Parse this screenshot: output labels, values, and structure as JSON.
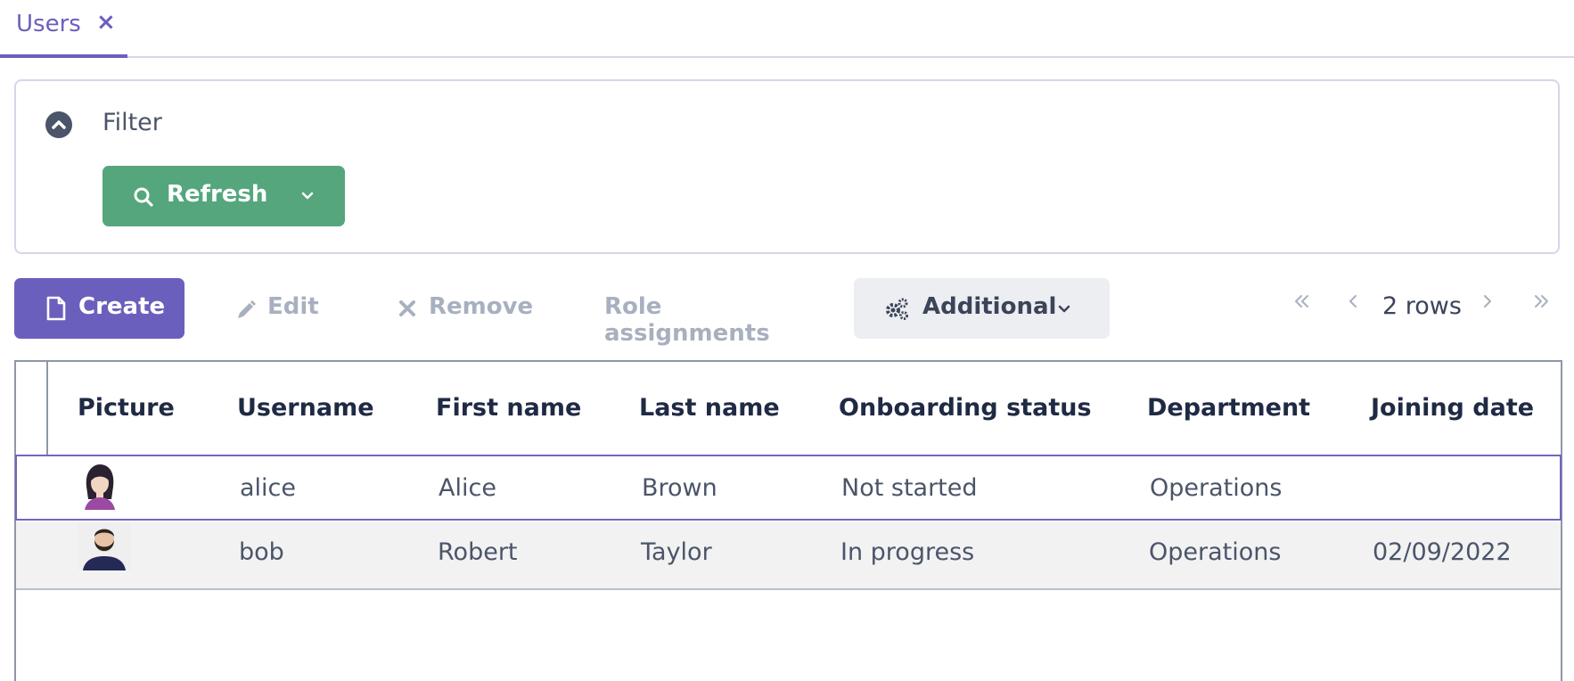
{
  "tabs": [
    {
      "label": "Users",
      "close": "×"
    }
  ],
  "filter": {
    "label": "Filter",
    "refresh_label": "Refresh"
  },
  "toolbar": {
    "create_label": "Create",
    "edit_label": "Edit",
    "remove_label": "Remove",
    "role_label": "Role assignments",
    "additional_label": "Additional"
  },
  "pager": {
    "rows_label": "2 rows"
  },
  "table": {
    "columns": [
      "Picture",
      "Username",
      "First name",
      "Last name",
      "Onboarding status",
      "Department",
      "Joining date"
    ],
    "rows": [
      {
        "username": "alice",
        "first_name": "Alice",
        "last_name": "Brown",
        "status": "Not started",
        "department": "Operations",
        "joining_date": ""
      },
      {
        "username": "bob",
        "first_name": "Robert",
        "last_name": "Taylor",
        "status": "In progress",
        "department": "Operations",
        "joining_date": "02/09/2022"
      }
    ]
  },
  "colors": {
    "accent": "#6b5fbd",
    "refresh": "#55a67c",
    "muted": "#a8b0bf"
  }
}
